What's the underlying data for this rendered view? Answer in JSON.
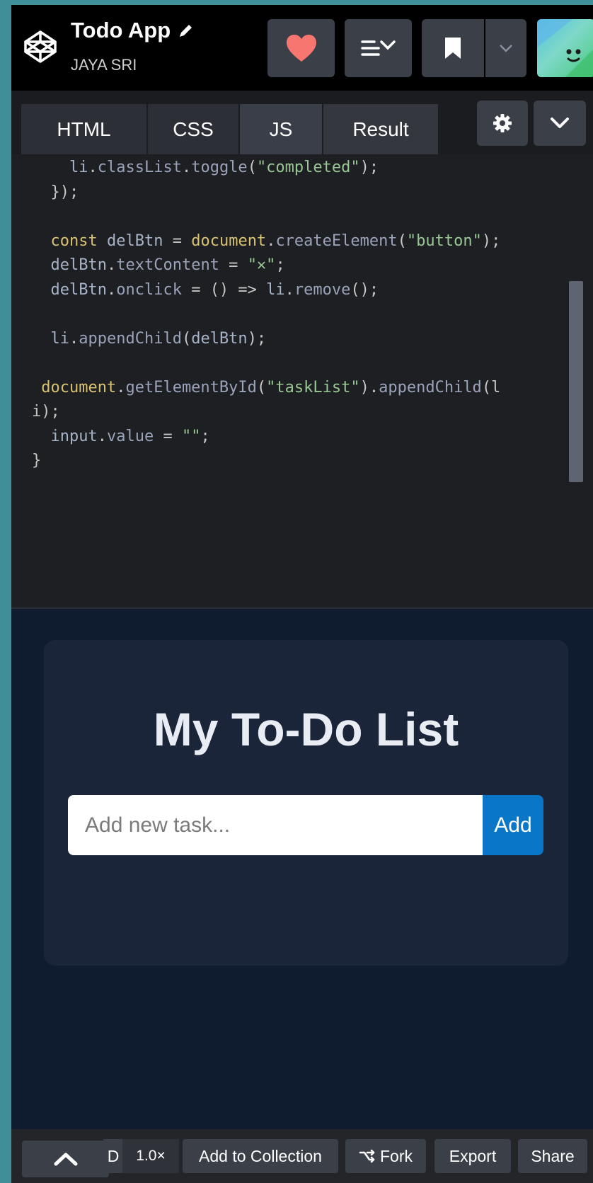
{
  "header": {
    "app_title": "Todo App",
    "author": "JAYA SRI",
    "icons": {
      "logo": "codepen-logo-icon",
      "edit": "pencil-icon",
      "like": "heart-icon",
      "info": "details-icon",
      "bookmark": "bookmark-icon",
      "more": "chevron-down-icon",
      "profile": "avatar"
    }
  },
  "tabs": [
    {
      "label": "HTML"
    },
    {
      "label": "CSS"
    },
    {
      "label": "JS",
      "active": true
    },
    {
      "label": "Result"
    }
  ],
  "editor": {
    "language": "JS",
    "lines": [
      "    li.classList.toggle(\"completed\");",
      "  });",
      "",
      "  const delBtn = document.createElement(\"button\");",
      "  delBtn.textContent = \"✕\";",
      "  delBtn.onclick = () => li.remove();",
      "",
      "  li.appendChild(delBtn);",
      "",
      " document.getElementById(\"taskList\").appendChild(l",
      "i);",
      "  input.value = \"\";",
      "}"
    ]
  },
  "result": {
    "title": "My To-Do List",
    "input_placeholder": "Add new task...",
    "input_value": "",
    "add_label": "Add"
  },
  "footer": {
    "collapse_icon": "chevron-up-icon",
    "truncated_label": "D",
    "zoom": "1.0×",
    "add_to_collection": "Add to Collection",
    "fork": "Fork",
    "fork_icon": "fork-icon",
    "export": "Export",
    "share": "Share"
  },
  "colors": {
    "like_heart": "#f7766f",
    "add_button": "#0a76c7",
    "result_background": "#0f1c30",
    "card_background": "#1b253a"
  }
}
